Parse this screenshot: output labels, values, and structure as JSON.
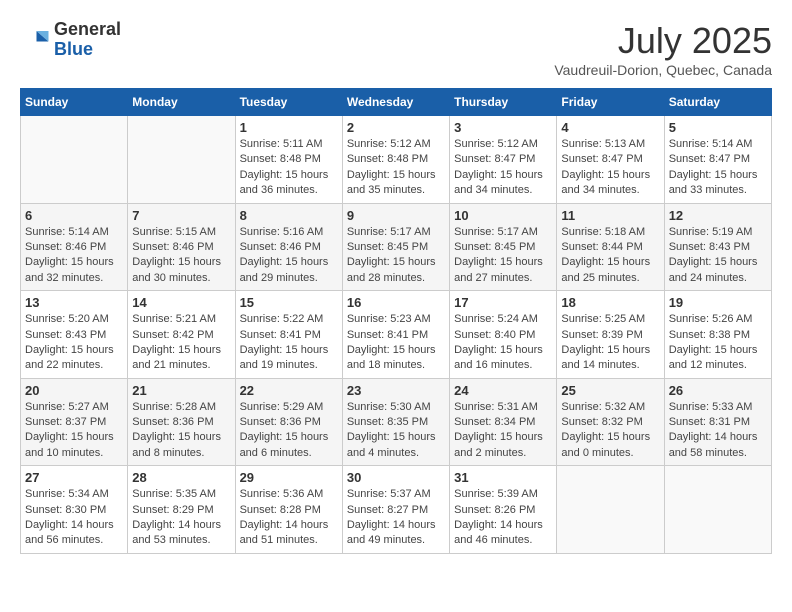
{
  "header": {
    "logo_general": "General",
    "logo_blue": "Blue",
    "month": "July 2025",
    "location": "Vaudreuil-Dorion, Quebec, Canada"
  },
  "days_of_week": [
    "Sunday",
    "Monday",
    "Tuesday",
    "Wednesday",
    "Thursday",
    "Friday",
    "Saturday"
  ],
  "weeks": [
    [
      {
        "day": "",
        "info": ""
      },
      {
        "day": "",
        "info": ""
      },
      {
        "day": "1",
        "info": "Sunrise: 5:11 AM\nSunset: 8:48 PM\nDaylight: 15 hours and 36 minutes."
      },
      {
        "day": "2",
        "info": "Sunrise: 5:12 AM\nSunset: 8:48 PM\nDaylight: 15 hours and 35 minutes."
      },
      {
        "day": "3",
        "info": "Sunrise: 5:12 AM\nSunset: 8:47 PM\nDaylight: 15 hours and 34 minutes."
      },
      {
        "day": "4",
        "info": "Sunrise: 5:13 AM\nSunset: 8:47 PM\nDaylight: 15 hours and 34 minutes."
      },
      {
        "day": "5",
        "info": "Sunrise: 5:14 AM\nSunset: 8:47 PM\nDaylight: 15 hours and 33 minutes."
      }
    ],
    [
      {
        "day": "6",
        "info": "Sunrise: 5:14 AM\nSunset: 8:46 PM\nDaylight: 15 hours and 32 minutes."
      },
      {
        "day": "7",
        "info": "Sunrise: 5:15 AM\nSunset: 8:46 PM\nDaylight: 15 hours and 30 minutes."
      },
      {
        "day": "8",
        "info": "Sunrise: 5:16 AM\nSunset: 8:46 PM\nDaylight: 15 hours and 29 minutes."
      },
      {
        "day": "9",
        "info": "Sunrise: 5:17 AM\nSunset: 8:45 PM\nDaylight: 15 hours and 28 minutes."
      },
      {
        "day": "10",
        "info": "Sunrise: 5:17 AM\nSunset: 8:45 PM\nDaylight: 15 hours and 27 minutes."
      },
      {
        "day": "11",
        "info": "Sunrise: 5:18 AM\nSunset: 8:44 PM\nDaylight: 15 hours and 25 minutes."
      },
      {
        "day": "12",
        "info": "Sunrise: 5:19 AM\nSunset: 8:43 PM\nDaylight: 15 hours and 24 minutes."
      }
    ],
    [
      {
        "day": "13",
        "info": "Sunrise: 5:20 AM\nSunset: 8:43 PM\nDaylight: 15 hours and 22 minutes."
      },
      {
        "day": "14",
        "info": "Sunrise: 5:21 AM\nSunset: 8:42 PM\nDaylight: 15 hours and 21 minutes."
      },
      {
        "day": "15",
        "info": "Sunrise: 5:22 AM\nSunset: 8:41 PM\nDaylight: 15 hours and 19 minutes."
      },
      {
        "day": "16",
        "info": "Sunrise: 5:23 AM\nSunset: 8:41 PM\nDaylight: 15 hours and 18 minutes."
      },
      {
        "day": "17",
        "info": "Sunrise: 5:24 AM\nSunset: 8:40 PM\nDaylight: 15 hours and 16 minutes."
      },
      {
        "day": "18",
        "info": "Sunrise: 5:25 AM\nSunset: 8:39 PM\nDaylight: 15 hours and 14 minutes."
      },
      {
        "day": "19",
        "info": "Sunrise: 5:26 AM\nSunset: 8:38 PM\nDaylight: 15 hours and 12 minutes."
      }
    ],
    [
      {
        "day": "20",
        "info": "Sunrise: 5:27 AM\nSunset: 8:37 PM\nDaylight: 15 hours and 10 minutes."
      },
      {
        "day": "21",
        "info": "Sunrise: 5:28 AM\nSunset: 8:36 PM\nDaylight: 15 hours and 8 minutes."
      },
      {
        "day": "22",
        "info": "Sunrise: 5:29 AM\nSunset: 8:36 PM\nDaylight: 15 hours and 6 minutes."
      },
      {
        "day": "23",
        "info": "Sunrise: 5:30 AM\nSunset: 8:35 PM\nDaylight: 15 hours and 4 minutes."
      },
      {
        "day": "24",
        "info": "Sunrise: 5:31 AM\nSunset: 8:34 PM\nDaylight: 15 hours and 2 minutes."
      },
      {
        "day": "25",
        "info": "Sunrise: 5:32 AM\nSunset: 8:32 PM\nDaylight: 15 hours and 0 minutes."
      },
      {
        "day": "26",
        "info": "Sunrise: 5:33 AM\nSunset: 8:31 PM\nDaylight: 14 hours and 58 minutes."
      }
    ],
    [
      {
        "day": "27",
        "info": "Sunrise: 5:34 AM\nSunset: 8:30 PM\nDaylight: 14 hours and 56 minutes."
      },
      {
        "day": "28",
        "info": "Sunrise: 5:35 AM\nSunset: 8:29 PM\nDaylight: 14 hours and 53 minutes."
      },
      {
        "day": "29",
        "info": "Sunrise: 5:36 AM\nSunset: 8:28 PM\nDaylight: 14 hours and 51 minutes."
      },
      {
        "day": "30",
        "info": "Sunrise: 5:37 AM\nSunset: 8:27 PM\nDaylight: 14 hours and 49 minutes."
      },
      {
        "day": "31",
        "info": "Sunrise: 5:39 AM\nSunset: 8:26 PM\nDaylight: 14 hours and 46 minutes."
      },
      {
        "day": "",
        "info": ""
      },
      {
        "day": "",
        "info": ""
      }
    ]
  ]
}
